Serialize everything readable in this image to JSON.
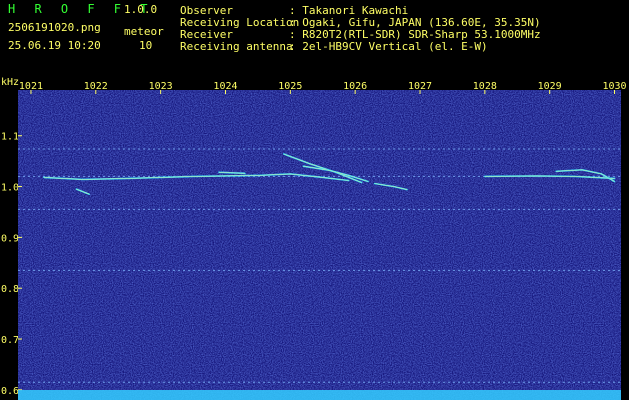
{
  "header": {
    "app_name": "H R O F F T",
    "version": "1.0.0",
    "filename": "2506191020.png",
    "mode_label": "meteor",
    "datetime": "25.06.19 10:20",
    "count": "10",
    "info": [
      {
        "label": "Observer",
        "value": ": Takanori Kawachi"
      },
      {
        "label": "Receiving Location",
        "value": ": Ogaki, Gifu, JAPAN (136.60E, 35.35N)"
      },
      {
        "label": "Receiver",
        "value": ": R820T2(RTL-SDR) SDR-Sharp 53.1000MHz"
      },
      {
        "label": "Receiving antenna",
        "value": ": 2el-HB9CV Vertical (el. E-W)"
      }
    ]
  },
  "colors": {
    "header_yellow": "#ffff66",
    "header_green": "#33ff33",
    "background": "#1a1a8c",
    "signal": "#33ddff"
  },
  "chart_data": {
    "type": "heatmap",
    "ylabel": "kHz",
    "x_ticks": [
      "1021",
      "1022",
      "1023",
      "1024",
      "1025",
      "1026",
      "1027",
      "1028",
      "1029",
      "1030"
    ],
    "y_ticks": [
      "1.1",
      "1.0",
      "0.9",
      "0.8",
      "0.7",
      "0.6"
    ],
    "xlim": [
      1020.8,
      1030.1
    ],
    "ylim": [
      0.58,
      1.19
    ],
    "carriers_khz": [
      1.074,
      1.02,
      0.955,
      0.835,
      0.615
    ],
    "meteor_traces": [
      {
        "x": [
          1021.2,
          1021.8,
          1022.5,
          1023.5,
          1024.5,
          1025.0,
          1025.5,
          1025.9
        ],
        "y": [
          1.018,
          1.014,
          1.016,
          1.02,
          1.022,
          1.025,
          1.018,
          1.012
        ]
      },
      {
        "x": [
          1024.9,
          1025.3,
          1025.7,
          1026.1
        ],
        "y": [
          1.064,
          1.045,
          1.028,
          1.008
        ]
      },
      {
        "x": [
          1025.2,
          1025.6,
          1025.9,
          1026.2
        ],
        "y": [
          1.04,
          1.032,
          1.022,
          1.01
        ]
      },
      {
        "x": [
          1026.3,
          1026.6,
          1026.8
        ],
        "y": [
          1.006,
          1.0,
          0.994
        ]
      },
      {
        "x": [
          1021.7,
          1021.9
        ],
        "y": [
          0.995,
          0.985
        ]
      },
      {
        "x": [
          1023.9,
          1024.3
        ],
        "y": [
          1.028,
          1.026
        ]
      },
      {
        "x": [
          1029.1,
          1029.5,
          1029.8,
          1030.0
        ],
        "y": [
          1.03,
          1.033,
          1.025,
          1.01
        ]
      },
      {
        "x": [
          1028.0,
          1028.8,
          1029.4,
          1030.0
        ],
        "y": [
          1.02,
          1.021,
          1.02,
          1.016
        ]
      }
    ]
  }
}
